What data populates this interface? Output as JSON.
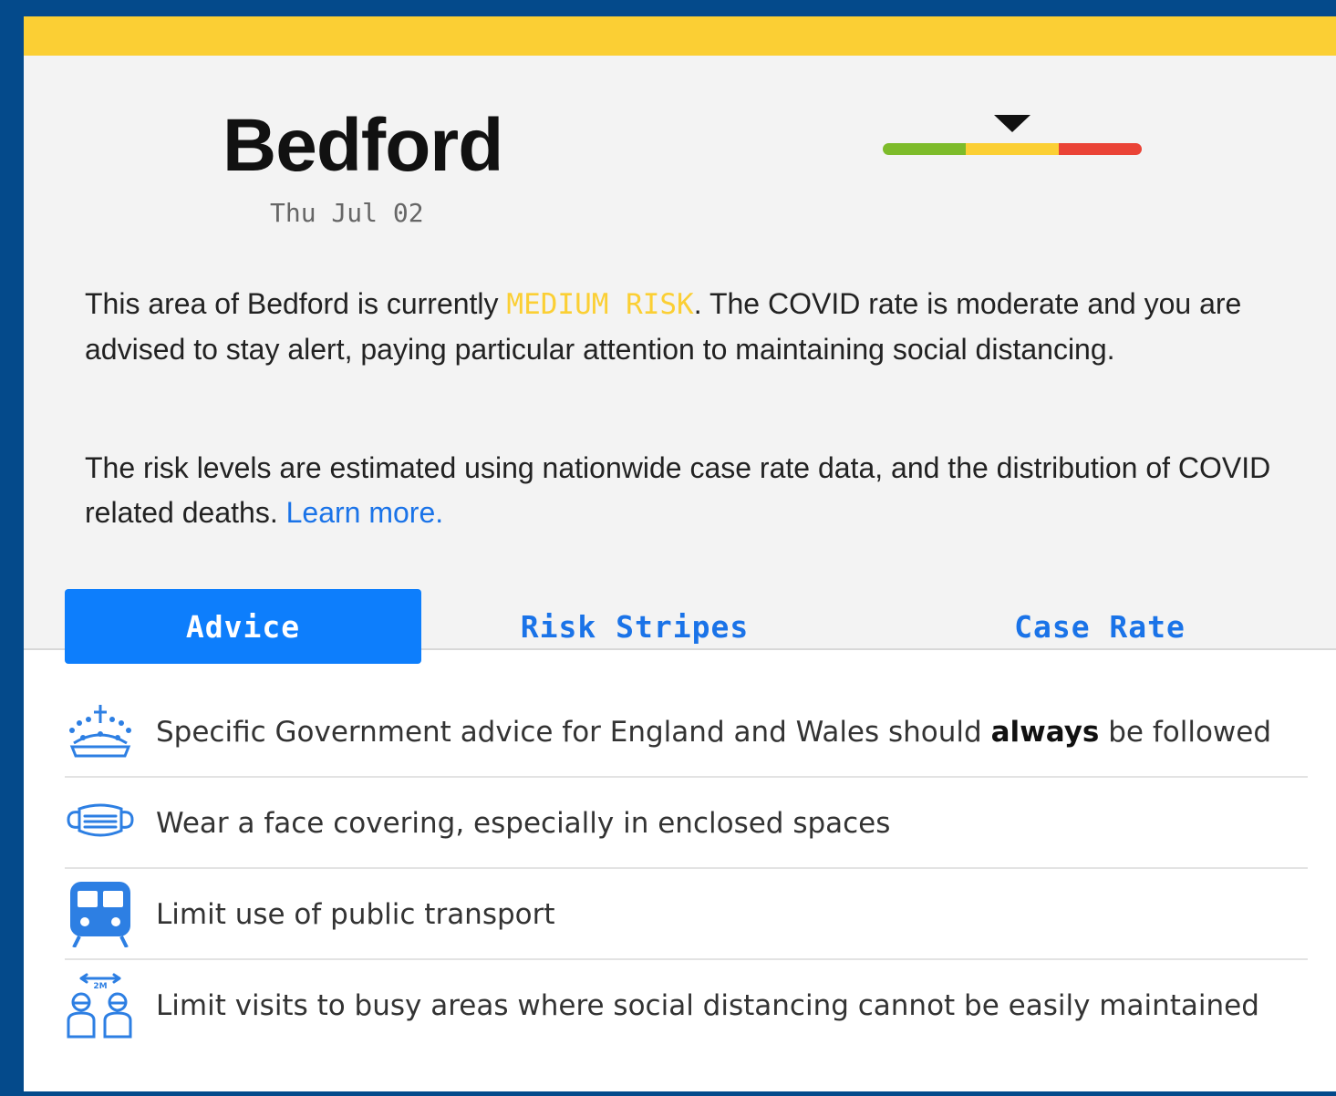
{
  "location": {
    "name": "Bedford",
    "date": "Thu Jul 02"
  },
  "risk_meter": {
    "level": "medium",
    "segments": [
      {
        "color": "#7dbb2a"
      },
      {
        "color": "#fbcf34"
      },
      {
        "color": "#ea4336"
      }
    ]
  },
  "summary": {
    "pre": "This area of Bedford is currently ",
    "risk_label": "MEDIUM RISK",
    "post": ". The COVID rate is moderate and you are advised to stay alert, paying particular attention to maintaining social distancing."
  },
  "method": {
    "text": "The risk levels are estimated using nationwide case rate data, and the distribution of COVID related deaths. ",
    "link_label": "Learn more."
  },
  "tabs": [
    {
      "label": "Advice",
      "active": true
    },
    {
      "label": "Risk Stripes",
      "active": false
    },
    {
      "label": "Case Rate",
      "active": false
    }
  ],
  "advice": [
    {
      "icon": "crown-icon",
      "pre": "Specific Government advice for England and Wales should ",
      "bold": "always",
      "post": " be followed"
    },
    {
      "icon": "face-mask-icon",
      "text": "Wear a face covering, especially in enclosed spaces"
    },
    {
      "icon": "train-icon",
      "text": "Limit use of public transport"
    },
    {
      "icon": "social-distancing-icon",
      "icon_label": "2M",
      "text": "Limit visits to busy areas where social distancing cannot be easily maintained"
    }
  ],
  "colors": {
    "accent": "#0d7efc",
    "link": "#1a73e8",
    "warning": "#fbcf34",
    "page_background": "#044a8b",
    "icon": "#2d7fe3"
  }
}
